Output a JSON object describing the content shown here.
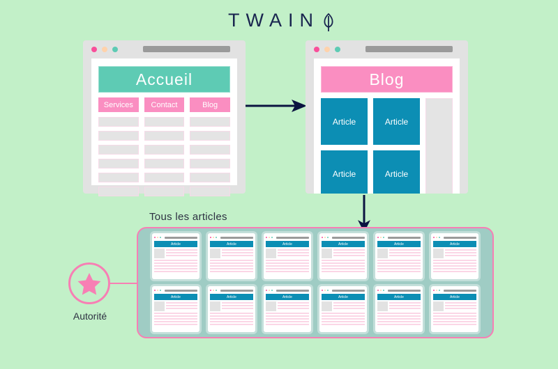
{
  "brand": {
    "name": "TWAIN",
    "leaf_icon": "leaf-icon",
    "text_color": "#19254f"
  },
  "colors": {
    "background": "#c2f0c8",
    "teal": "#5ecbb4",
    "pink": "#fa8ec1",
    "article_blue": "#0c8eb4",
    "panel": "#9fccc4",
    "panel_border": "#f77fb4",
    "arrow": "#0b1340",
    "text_dark": "#2d3142"
  },
  "window_home": {
    "name": "homepage-window",
    "dots": [
      "close-dot",
      "minimize-dot",
      "maximize-dot"
    ],
    "hero_label": "Accueil",
    "nav_buttons": [
      {
        "label": "Services"
      },
      {
        "label": "Contact"
      },
      {
        "label": "Blog"
      }
    ],
    "placeholder_rows": 6,
    "placeholder_cols": 3
  },
  "window_blog": {
    "name": "blog-window",
    "dots": [
      "close-dot",
      "minimize-dot",
      "maximize-dot"
    ],
    "hero_label": "Blog",
    "article_tiles": [
      {
        "label": "Article"
      },
      {
        "label": "Article"
      },
      {
        "label": "Article"
      },
      {
        "label": "Article"
      }
    ],
    "sidebar_placeholder": ""
  },
  "arrows": [
    {
      "name": "arrow-home-to-blog",
      "direction": "right"
    },
    {
      "name": "arrow-blog-to-panel",
      "direction": "down"
    }
  ],
  "panel": {
    "title": "Tous les articles",
    "rows": [
      [
        {
          "label": "Article"
        },
        {
          "label": "Article"
        },
        {
          "label": "Article"
        },
        {
          "label": "Article"
        },
        {
          "label": "Article"
        },
        {
          "label": "Article"
        }
      ],
      [
        {
          "label": "Article"
        },
        {
          "label": "Article"
        },
        {
          "label": "Article"
        },
        {
          "label": "Article"
        },
        {
          "label": "Article"
        },
        {
          "label": "Article"
        }
      ]
    ]
  },
  "authority": {
    "label": "Autorité",
    "icon": "star-icon"
  }
}
